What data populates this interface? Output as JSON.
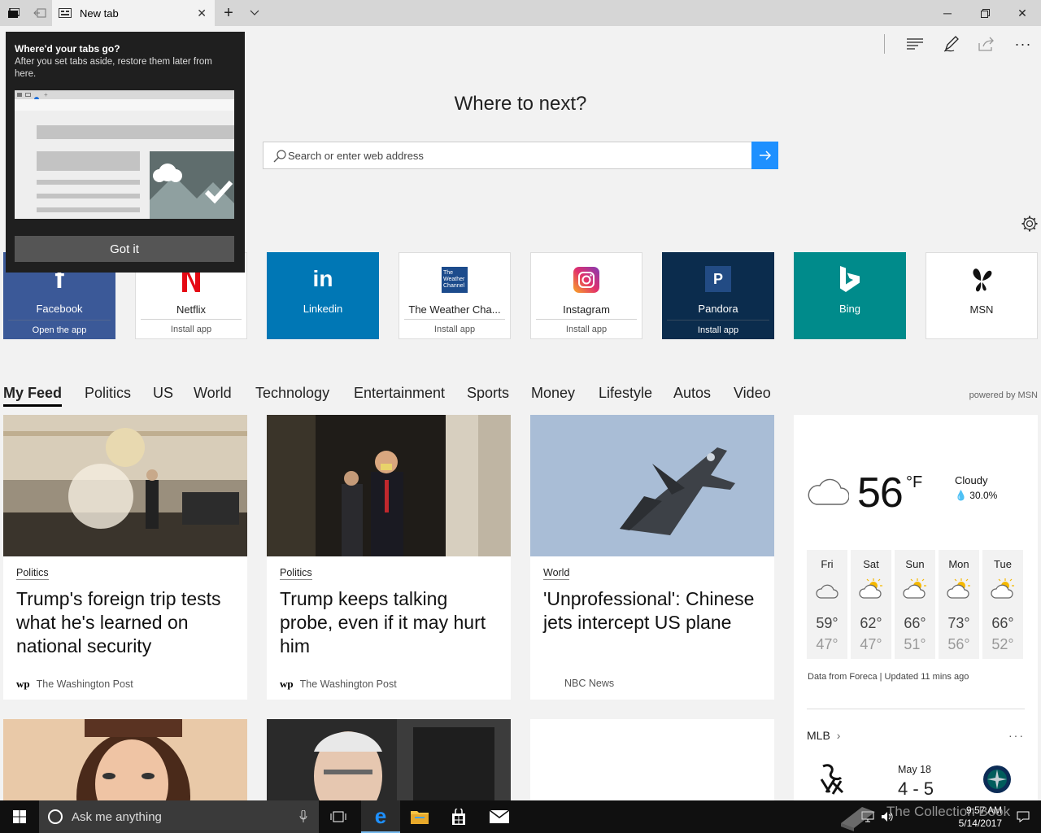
{
  "browser": {
    "tab_title": "New tab",
    "search_placeholder": "Search or enter web address"
  },
  "page": {
    "heading": "Where to next?",
    "powered_by": "powered by MSN"
  },
  "popup": {
    "title": "Where'd your tabs go?",
    "body": "After you set tabs aside, restore them later from here.",
    "button": "Got it"
  },
  "tiles": [
    {
      "name": "Facebook",
      "sub": "Open the app",
      "bg": "#3b5998",
      "fg": "#ffffff"
    },
    {
      "name": "Netflix",
      "sub": "Install app",
      "bg": "#ffffff",
      "fg": "#222222"
    },
    {
      "name": "Linkedin",
      "sub": "",
      "bg": "#0077b5",
      "fg": "#ffffff"
    },
    {
      "name": "The Weather Cha...",
      "sub": "Install app",
      "bg": "#ffffff",
      "fg": "#222222"
    },
    {
      "name": "Instagram",
      "sub": "Install app",
      "bg": "#ffffff",
      "fg": "#222222"
    },
    {
      "name": "Pandora",
      "sub": "Install app",
      "bg": "#0b2c4d",
      "fg": "#ffffff"
    },
    {
      "name": "Bing",
      "sub": "",
      "bg": "#008b8b",
      "fg": "#ffffff"
    },
    {
      "name": "MSN",
      "sub": "",
      "bg": "#ffffff",
      "fg": "#222222"
    }
  ],
  "weather_logo_text": [
    "The",
    "Weather",
    "Channel"
  ],
  "nav": [
    "My Feed",
    "Politics",
    "US",
    "World",
    "Technology",
    "Entertainment",
    "Sports",
    "Money",
    "Lifestyle",
    "Autos",
    "Video"
  ],
  "cards": [
    {
      "category": "Politics",
      "headline": "Trump's foreign trip tests what he's learned on national security",
      "source": "The Washington Post",
      "source_logo": "wp"
    },
    {
      "category": "Politics",
      "headline": "Trump keeps talking probe, even if it may hurt him",
      "source": "The Washington Post",
      "source_logo": "wp"
    },
    {
      "category": "World",
      "headline": "'Unprofessional': Chinese jets intercept US plane",
      "source": "NBC News",
      "source_logo": "nbc"
    }
  ],
  "weather": {
    "temp": "56",
    "unit": "°F",
    "condition": "Cloudy",
    "precip": "30.0%",
    "forecast": [
      {
        "day": "Fri",
        "hi": "59°",
        "lo": "47°"
      },
      {
        "day": "Sat",
        "hi": "62°",
        "lo": "47°"
      },
      {
        "day": "Sun",
        "hi": "66°",
        "lo": "51°"
      },
      {
        "day": "Mon",
        "hi": "73°",
        "lo": "56°"
      },
      {
        "day": "Tue",
        "hi": "66°",
        "lo": "52°"
      }
    ],
    "footer": "Data from Foreca | Updated 11 mins ago"
  },
  "mlb": {
    "title": "MLB",
    "date": "May 18",
    "score": "4 - 5"
  },
  "taskbar": {
    "cortana_placeholder": "Ask me anything",
    "time": "9:57 AM",
    "date": "5/14/2017"
  },
  "watermark": "The Collection Book",
  "colors": {
    "accent": "#1e90ff",
    "taskbar": "#101010"
  }
}
